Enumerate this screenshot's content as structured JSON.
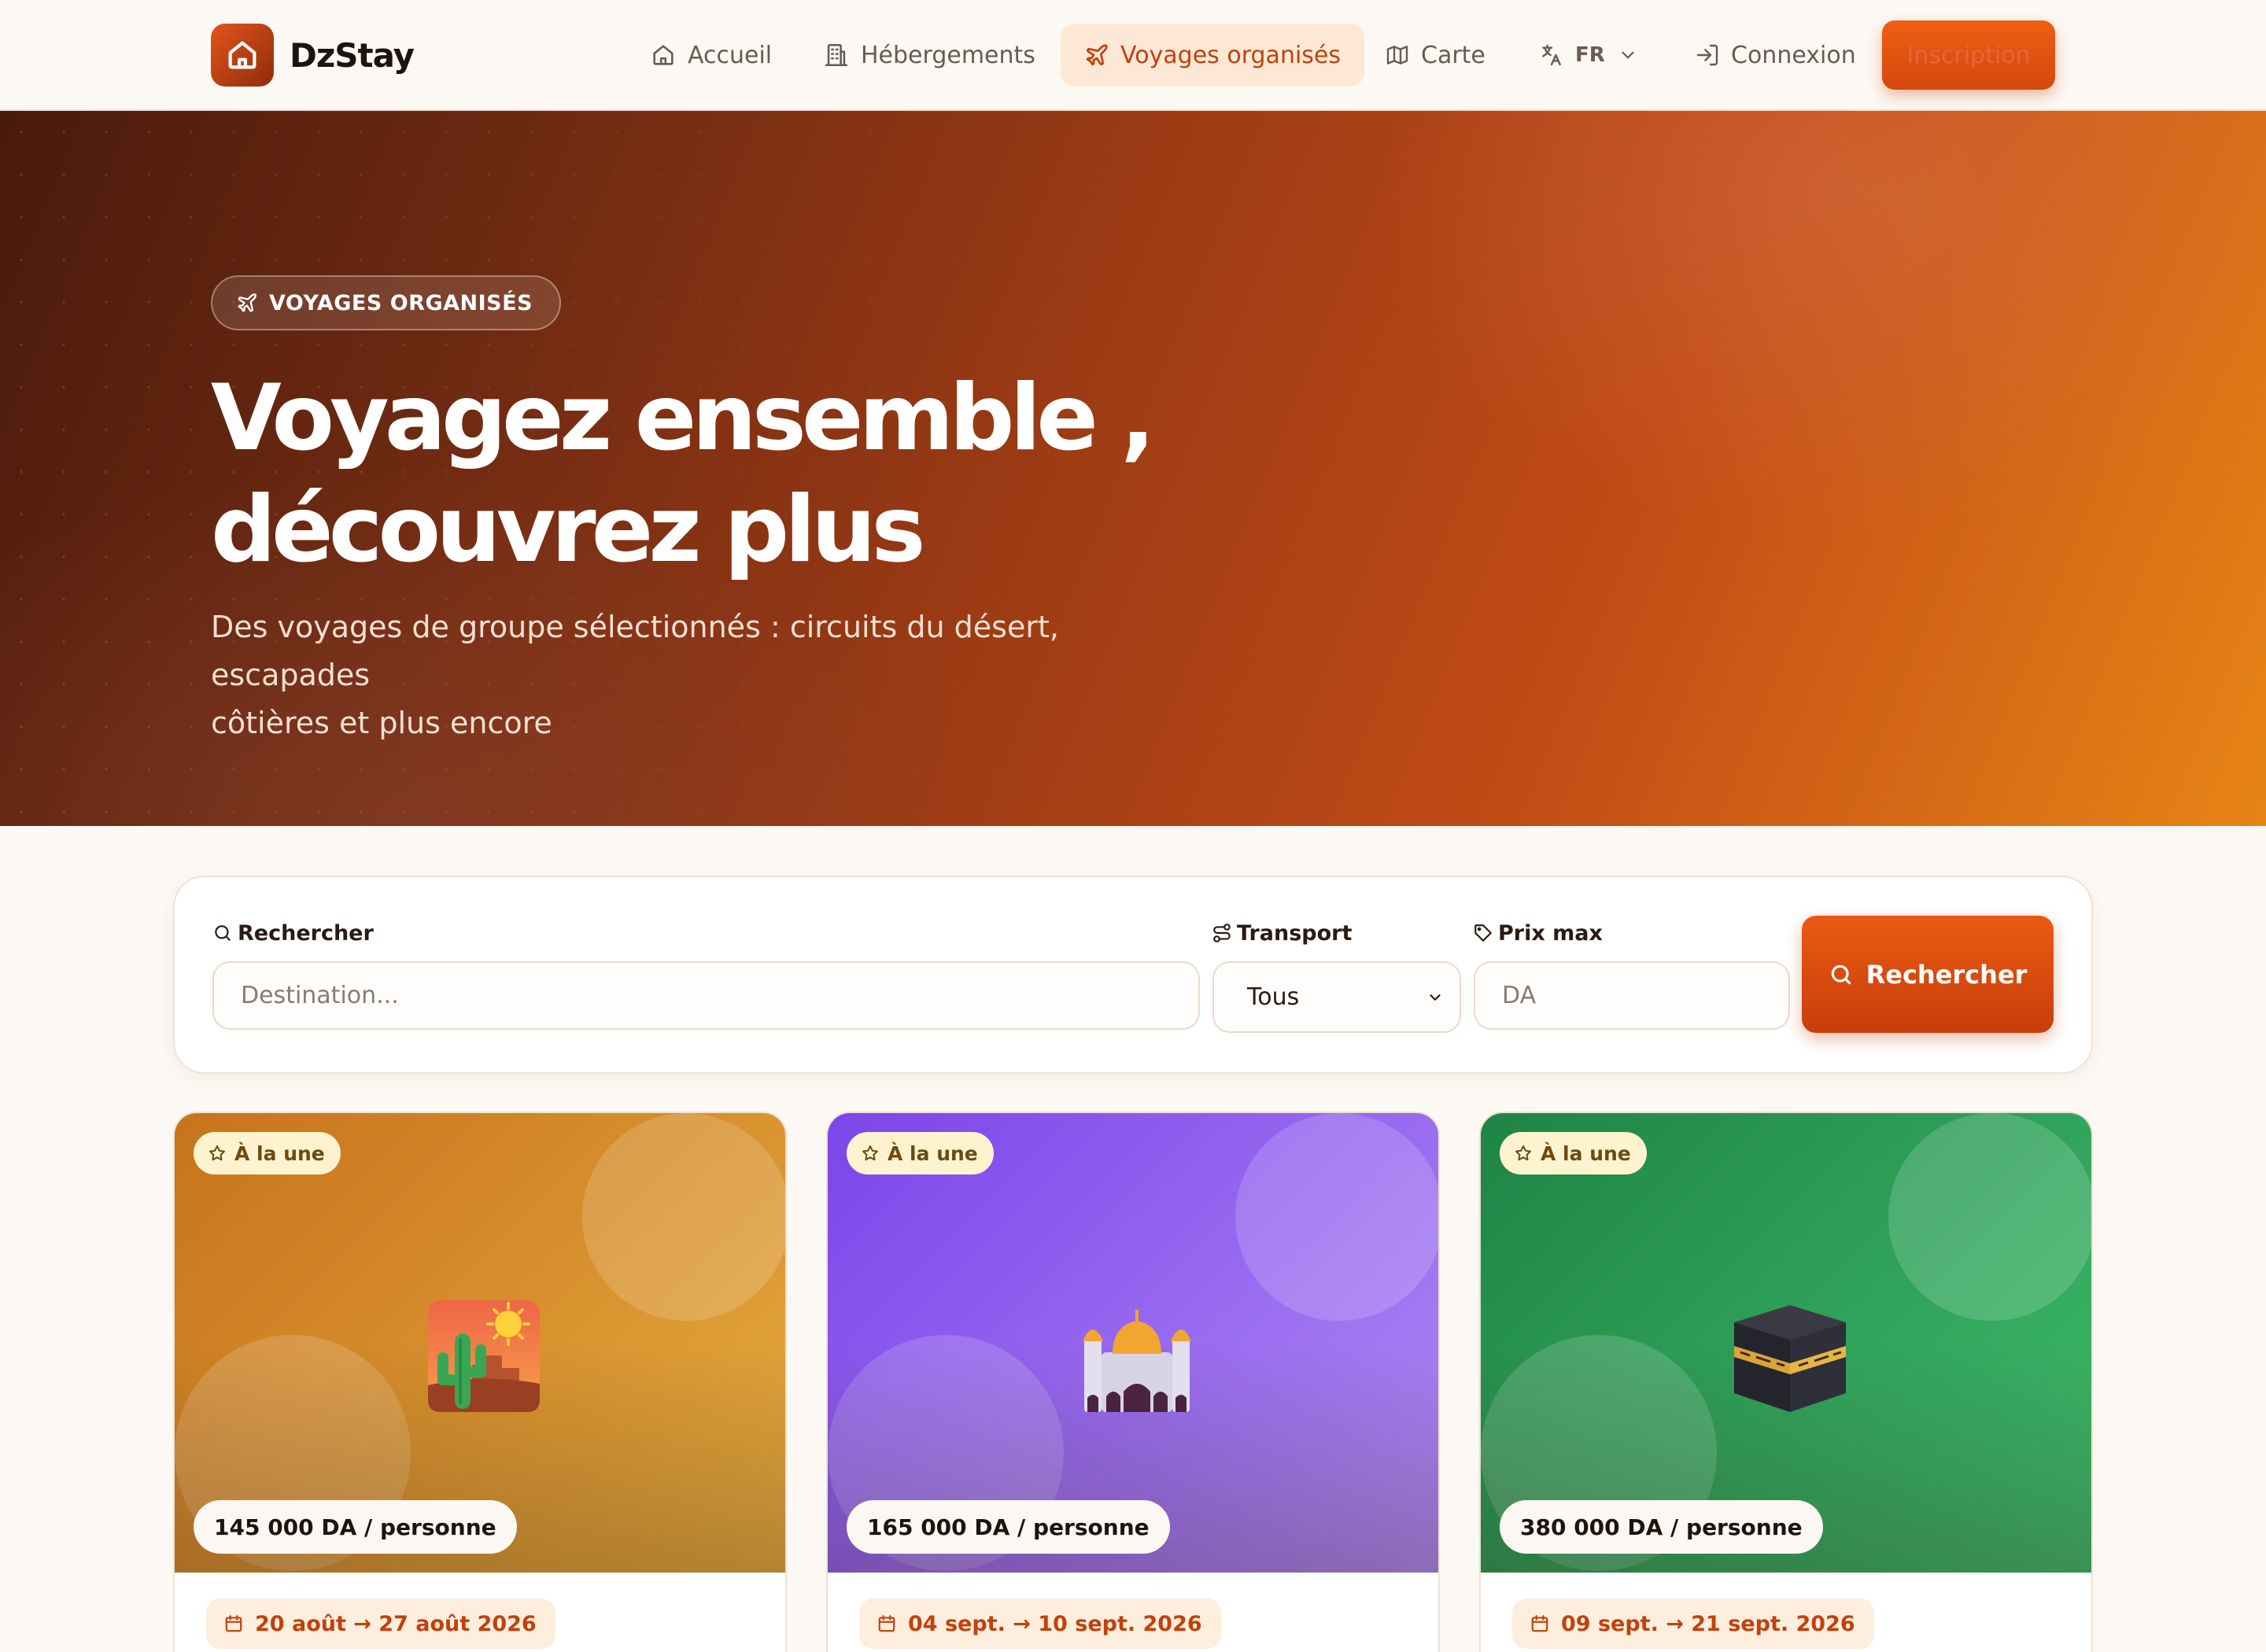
{
  "brand": {
    "name": "DzStay"
  },
  "nav": {
    "home": "Accueil",
    "accommodations": "Hébergements",
    "tours": "Voyages organisés",
    "map": "Carte",
    "language": "FR",
    "login": "Connexion",
    "signup": "Inscription"
  },
  "hero": {
    "badge": "VOYAGES ORGANISÉS",
    "title_line1": "Voyagez ensemble ,",
    "title_line2": "découvrez plus",
    "subtitle_line1": "Des voyages de groupe sélectionnés : circuits du désert, escapades",
    "subtitle_line2": "côtières et plus encore"
  },
  "search": {
    "query_label": "Rechercher",
    "query_placeholder": "Destination...",
    "transport_label": "Transport",
    "transport_value": "Tous",
    "price_label": "Prix max",
    "price_placeholder": "DA",
    "button_label": "Rechercher"
  },
  "trips": [
    {
      "featured_label": "À la une",
      "price": "145 000 DA / personne",
      "dates": "20 août → 27 août 2026",
      "icon": "desert-icon",
      "colors": {
        "top": "#c8731c",
        "bottom": "#e6ac3e"
      }
    },
    {
      "featured_label": "À la une",
      "price": "165 000 DA / personne",
      "dates": "04 sept. → 10 sept. 2026",
      "icon": "mosque-icon",
      "colors": {
        "top": "#7c45ea",
        "bottom": "#b08af5"
      }
    },
    {
      "featured_label": "À la une",
      "price": "380 000 DA / personne",
      "dates": "09 sept. → 21 sept. 2026",
      "icon": "kaaba-icon",
      "colors": {
        "top": "#1f8446",
        "bottom": "#3ebd6b"
      }
    }
  ],
  "colors": {
    "accent": "#e5531a",
    "accent_dark": "#c2410c",
    "page_background": "#fcf8f3"
  }
}
